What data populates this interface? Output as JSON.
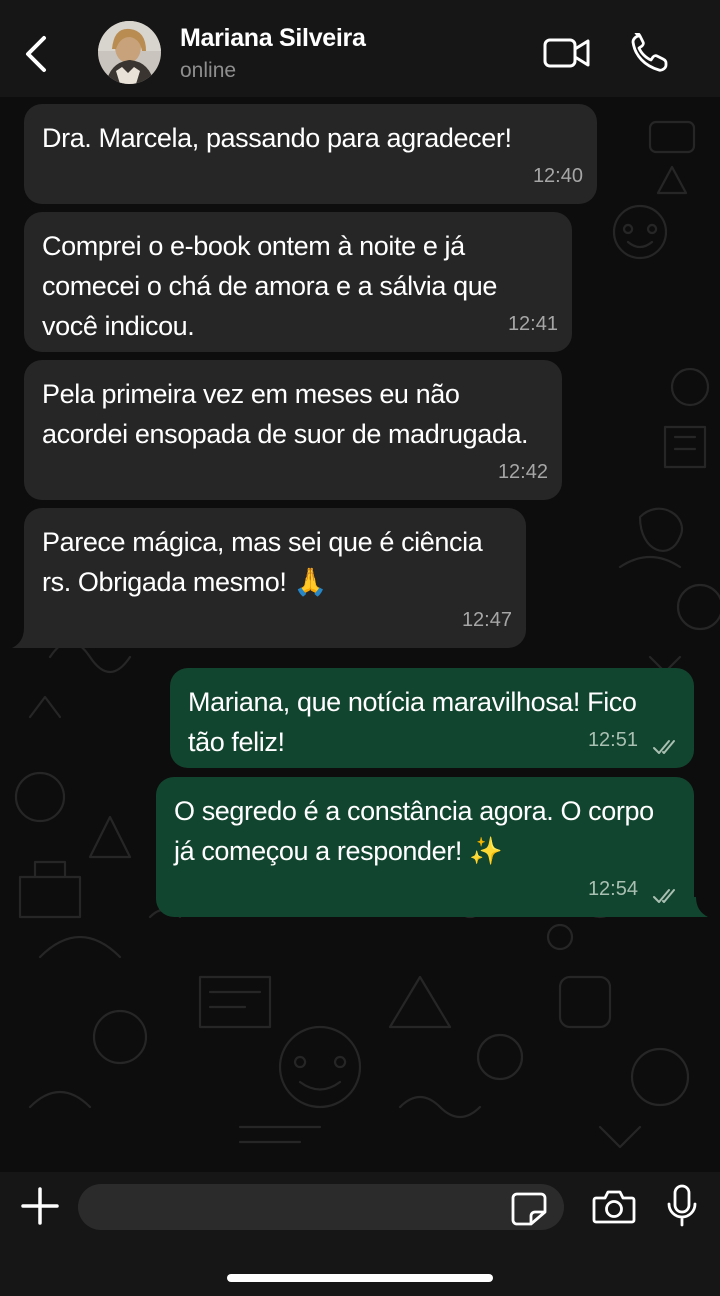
{
  "header": {
    "contact_name": "Mariana Silveira",
    "status": "online",
    "back_icon": "chevron-left-icon",
    "video_icon": "video-camera-icon",
    "call_icon": "phone-icon"
  },
  "messages": [
    {
      "direction": "incoming",
      "text": "Dra. Marcela, passando para agradecer!",
      "time": "12:40"
    },
    {
      "direction": "incoming",
      "text": "Comprei o e-book ontem à noite e já comecei o chá de amora e a sálvia que você indicou.",
      "time": "12:41"
    },
    {
      "direction": "incoming",
      "text": "Pela primeira vez em meses eu não acordei ensopada de suor de madrugada.",
      "time": "12:42"
    },
    {
      "direction": "incoming",
      "text": "Parece mágica, mas sei que é ciência rs. Obrigada mesmo! 🙏",
      "time": "12:47"
    },
    {
      "direction": "outgoing",
      "text": "Mariana, que notícia maravilhosa! Fico tão feliz!",
      "time": "12:51",
      "status": "read"
    },
    {
      "direction": "outgoing",
      "text": "O segredo é a constância agora. O corpo já começou a responder! ✨",
      "time": "12:54",
      "status": "read"
    }
  ],
  "composer": {
    "placeholder": "",
    "plus_icon": "plus-icon",
    "sticker_icon": "sticker-icon",
    "camera_icon": "camera-icon",
    "mic_icon": "microphone-icon"
  },
  "colors": {
    "incoming_bubble": "#262626",
    "outgoing_bubble": "#12452f",
    "background": "#0d0d0d"
  }
}
